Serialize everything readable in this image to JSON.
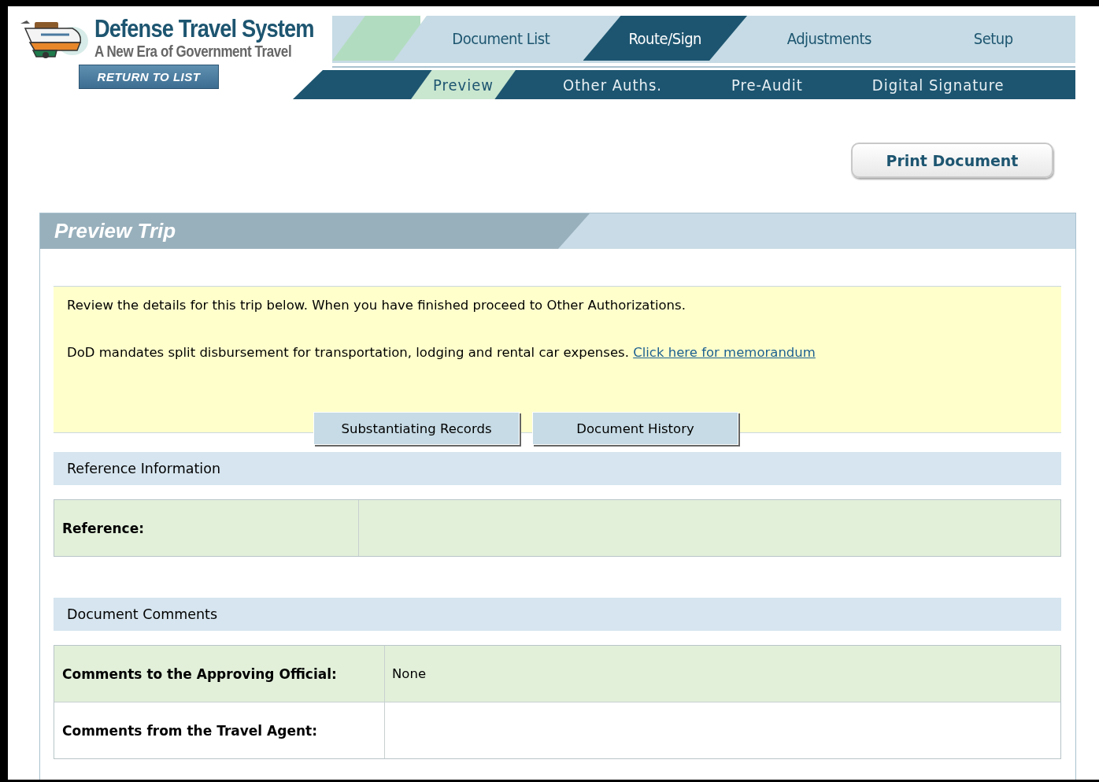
{
  "logo": {
    "title": "Defense Travel System",
    "subtitle": "A New Era of Government Travel"
  },
  "return_button": "RETURN TO LIST",
  "main_tabs": [
    {
      "label": "Document List",
      "selected": false
    },
    {
      "label": "Route/Sign",
      "selected": true
    },
    {
      "label": "Adjustments",
      "selected": false
    },
    {
      "label": "Setup",
      "selected": false
    }
  ],
  "sub_tabs": [
    {
      "label": "Preview",
      "selected": true
    },
    {
      "label": "Other Auths.",
      "selected": false
    },
    {
      "label": "Pre-Audit",
      "selected": false
    },
    {
      "label": "Digital Signature",
      "selected": false
    }
  ],
  "print_button": "Print Document",
  "panel": {
    "title": "Preview Trip",
    "notice": {
      "lines": [
        "Review the details for this trip below. When you have finished proceed to Other Authorizations.",
        "DoD mandates split disbursement for transportation, lodging and rental car expenses."
      ],
      "link": "Click here for memorandum",
      "buttons": [
        "Substantiating Records",
        "Document History"
      ]
    },
    "sections": [
      {
        "title": "Reference Information",
        "rows": [
          {
            "label": "Reference:"
          }
        ]
      },
      {
        "title": "Document Comments",
        "rows": [
          {
            "label": "Comments to the Approving Official:",
            "value": "None"
          },
          {
            "label": "Comments from the Travel Agent:"
          }
        ]
      }
    ]
  }
}
